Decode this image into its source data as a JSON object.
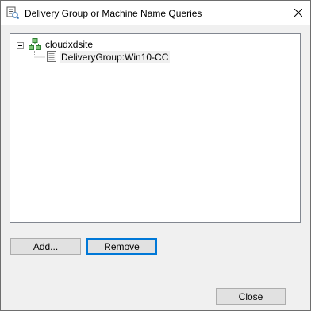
{
  "window": {
    "title": "Delivery Group or Machine Name Queries",
    "title_icon": "query-dialog-icon",
    "close_icon": "close-icon"
  },
  "tree": {
    "root": {
      "label": "cloudxdsite",
      "icon": "site-icon",
      "expanded": true
    },
    "children": [
      {
        "label": "DeliveryGroup:Win10-CC",
        "icon": "document-icon",
        "selected": true
      }
    ]
  },
  "buttons": {
    "add": "Add...",
    "remove": "Remove",
    "close": "Close"
  },
  "colors": {
    "focus_border": "#0078d7",
    "site_icon_green": "#3a9a3a",
    "button_face": "#e1e1e1"
  }
}
